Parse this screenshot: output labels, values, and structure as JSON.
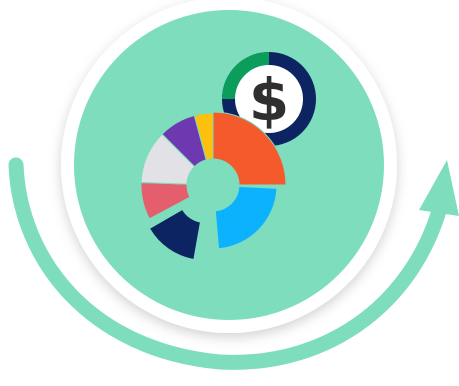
{
  "graphic": {
    "dollar_symbol": "$",
    "icons": [
      "donut-chart-icon",
      "dollar-coin-icon",
      "cycle-arrow-icon"
    ],
    "colors": {
      "mint": "#7dddbd",
      "white_ring": "#ffffff",
      "arrow": "#7dddbd",
      "coin_navy": "#0c2461",
      "coin_green": "#0a9e5a",
      "coin_face": "#ffffff",
      "dollar": "#2f2f2f",
      "seg_orange": "#f45a2c",
      "seg_blue": "#0db2ff",
      "seg_navy": "#0c2461",
      "seg_pink": "#e45e6e",
      "seg_gray": "#e1e1e6",
      "seg_purple": "#6e38b1",
      "seg_yellow": "#fbc10d"
    }
  }
}
